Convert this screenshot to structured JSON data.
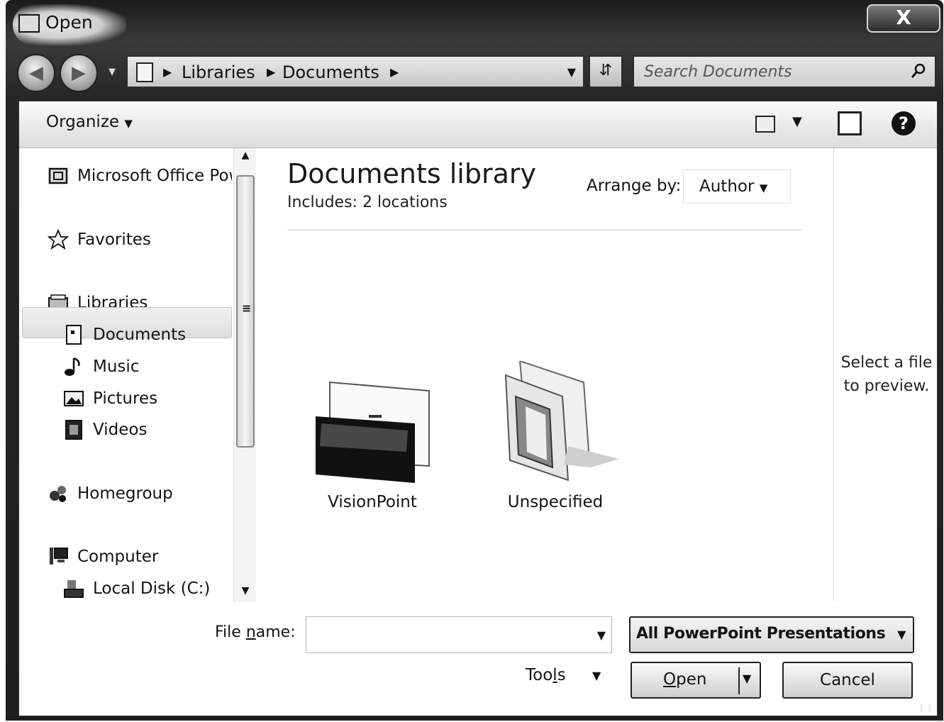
{
  "window": {
    "title": "Open",
    "close_label": "X"
  },
  "address": {
    "crumbs": [
      "Libraries",
      "Documents"
    ],
    "search_placeholder": "Search Documents"
  },
  "toolbar": {
    "organize_label": "Organize"
  },
  "nav": {
    "office": "Microsoft Office PowerPoint",
    "favorites": "Favorites",
    "libraries": "Libraries",
    "documents": "Documents",
    "music": "Music",
    "pictures": "Pictures",
    "videos": "Videos",
    "homegroup": "Homegroup",
    "computer": "Computer",
    "local_disk": "Local Disk (C:)"
  },
  "library": {
    "title": "Documents library",
    "includes_label": "Includes:",
    "includes_value": "2 locations",
    "arrange_label": "Arrange by:",
    "arrange_value": "Author"
  },
  "files": [
    {
      "label": "VisionPoint"
    },
    {
      "label": "Unspecified"
    }
  ],
  "preview": {
    "line1": "Select a file",
    "line2": "to preview."
  },
  "bottom": {
    "filename_label_pre": "File ",
    "filename_label_u": "n",
    "filename_label_post": "ame:",
    "filename_value": "",
    "filetype_value": "All PowerPoint Presentations",
    "tools_pre": "Too",
    "tools_u": "l",
    "tools_post": "s",
    "open_u": "O",
    "open_post": "pen",
    "cancel_label": "Cancel"
  }
}
